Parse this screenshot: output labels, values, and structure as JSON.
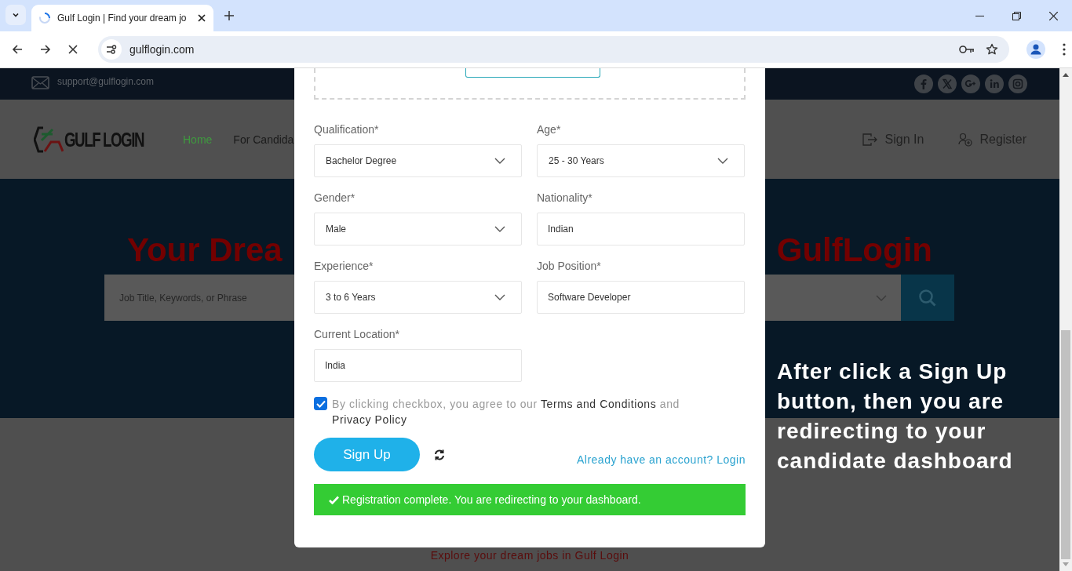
{
  "browser": {
    "tab_title": "Gulf Login | Find your dream jo",
    "loading": true,
    "url": "gulflogin.com"
  },
  "topbar": {
    "email": "support@gulflogin.com"
  },
  "header": {
    "logo_text": "GULF LOGIN",
    "nav": [
      {
        "label": "Home",
        "selected": true
      },
      {
        "label": "For Candida",
        "selected": false
      }
    ],
    "actions": [
      {
        "label": "Sign In",
        "kind": "signin"
      },
      {
        "label": "Register",
        "kind": "register"
      }
    ]
  },
  "hero": {
    "title_left": "Your Drea",
    "title_right": "GulfLogin",
    "search_placeholder": "Job Title, Keywords, or Phrase"
  },
  "footer_text": "Explore your dream jobs in Gulf Login",
  "modal": {
    "fields": [
      {
        "label": "Qualification*",
        "value": "Bachelor Degree",
        "kind": "select"
      },
      {
        "label": "Age*",
        "value": "25 - 30 Years",
        "kind": "select"
      },
      {
        "label": "Gender*",
        "value": "Male",
        "kind": "select"
      },
      {
        "label": "Nationality*",
        "value": "Indian",
        "kind": "text"
      },
      {
        "label": "Experience*",
        "value": "3 to 6 Years",
        "kind": "select"
      },
      {
        "label": "Job Position*",
        "value": "Software Developer",
        "kind": "text"
      },
      {
        "label": "Current Location*",
        "value": "India",
        "kind": "text"
      }
    ],
    "agree": {
      "checked": true,
      "parts": [
        {
          "text": "By clicking checkbox, you agree to our ",
          "kind": "plain"
        },
        {
          "text": "Terms and Conditions",
          "kind": "link"
        },
        {
          "text": " and ",
          "kind": "plain"
        },
        {
          "text": "Privacy Policy",
          "kind": "link"
        }
      ]
    },
    "submit": "Sign Up",
    "login_link": "Already have an account? Login",
    "alert": {
      "kind": "success",
      "text": "Registration complete. You are redirecting to your dashboard."
    }
  },
  "annotation": "After click a Sign Up button, then you are redirecting to your candidate dashboard"
}
